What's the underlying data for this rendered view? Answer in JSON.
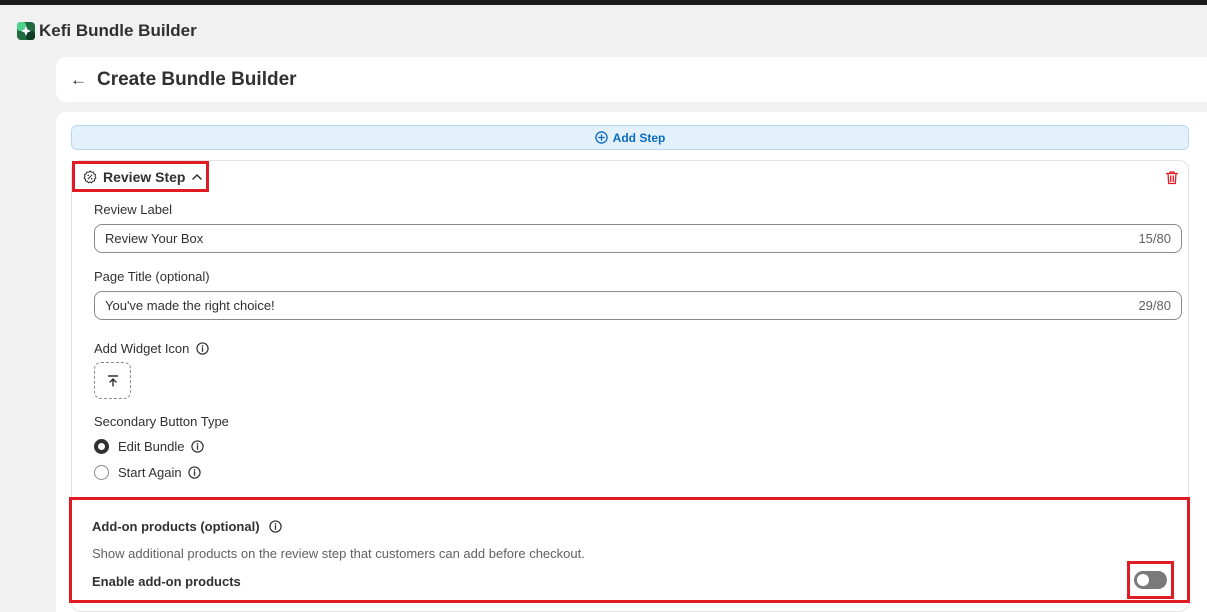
{
  "app": {
    "title": "Kefi Bundle Builder"
  },
  "header": {
    "title": "Create Bundle Builder"
  },
  "add_step": {
    "label": "Add Step"
  },
  "step": {
    "title": "Review Step",
    "review_label": {
      "label": "Review Label",
      "value": "Review Your Box",
      "counter": "15/80"
    },
    "page_title": {
      "label": "Page Title (optional)",
      "value": "You've made the right choice!",
      "counter": "29/80"
    },
    "widget_icon": {
      "label": "Add Widget Icon"
    },
    "secondary_button": {
      "label": "Secondary Button Type",
      "options": [
        {
          "label": "Edit Bundle",
          "selected": true
        },
        {
          "label": "Start Again",
          "selected": false
        }
      ]
    }
  },
  "addon": {
    "title": "Add-on products (optional)",
    "description": "Show additional products on the review step that customers can add before checkout.",
    "enable_label": "Enable add-on products",
    "enabled": false
  },
  "colors": {
    "accent": "#0b6cbf",
    "danger": "#e01b24",
    "toggle_off": "#7a7a7a"
  }
}
